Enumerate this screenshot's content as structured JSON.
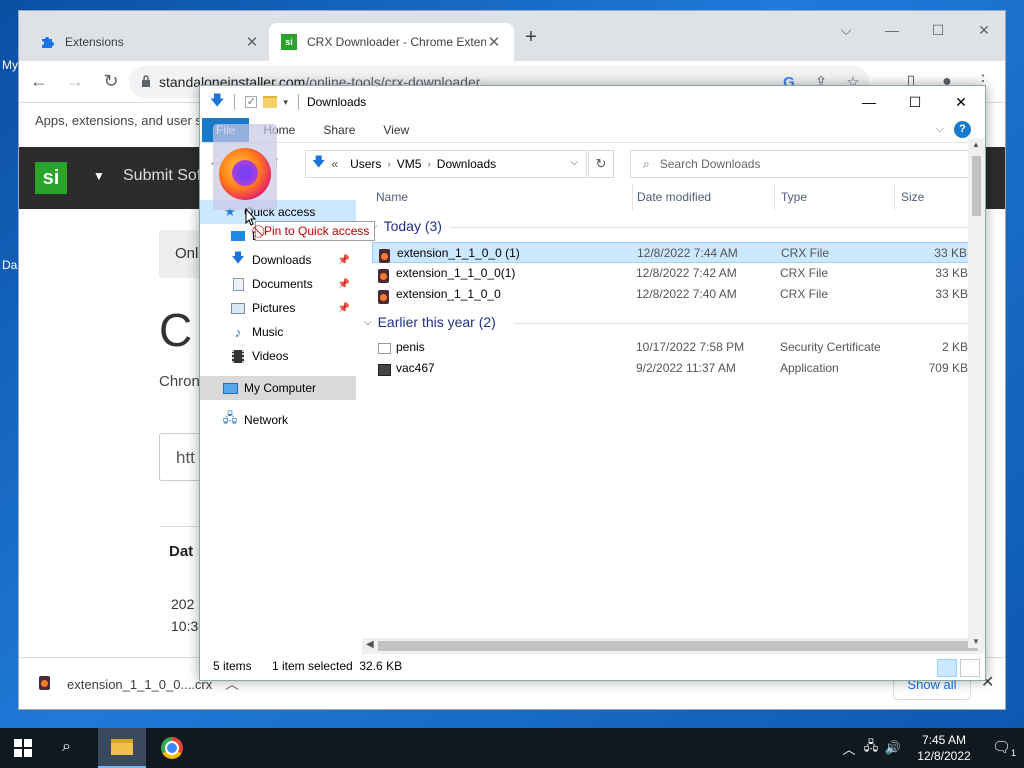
{
  "desktop": {
    "labels": [
      "My",
      "Da"
    ]
  },
  "browser": {
    "tabs": [
      {
        "title": "Extensions",
        "icon": "puzzle-icon",
        "active": false
      },
      {
        "title": "CRX Downloader - Chrome Exten",
        "icon": "si-favicon",
        "active": true
      }
    ],
    "url_host": "standaloneinstaller.com",
    "url_path": "/online-tools/crx-downloader"
  },
  "page": {
    "apps_text": "Apps, extensions, and user sc",
    "site_logo": "si",
    "submit_label": "Submit Sof",
    "pill_text": "Onl",
    "big_letter": "C",
    "chrome_text": "Chron",
    "input_text": "htt",
    "date_header": "Dat",
    "date_line1": "202",
    "date_line2": "10:3"
  },
  "download_bar": {
    "file_name": "extension_1_1_0_0....crx",
    "show_all": "Show all"
  },
  "explorer": {
    "title": "Downloads",
    "ribbon_tabs": [
      "File",
      "Home",
      "Share",
      "View"
    ],
    "breadcrumb": [
      "Users",
      "VM5",
      "Downloads"
    ],
    "search_placeholder": "Search Downloads",
    "nav": {
      "quick_access": "Quick access",
      "desktop": "D",
      "downloads": "Downloads",
      "documents": "Documents",
      "pictures": "Pictures",
      "music": "Music",
      "videos": "Videos",
      "my_computer": "My Computer",
      "network": "Network"
    },
    "columns": {
      "name": "Name",
      "date": "Date modified",
      "type": "Type",
      "size": "Size"
    },
    "groups": [
      {
        "label": "Today (3)",
        "files": [
          {
            "name": "extension_1_1_0_0 (1)",
            "date": "12/8/2022 7:44 AM",
            "type": "CRX File",
            "size": "33 KB",
            "selected": true
          },
          {
            "name": "extension_1_1_0_0(1)",
            "date": "12/8/2022 7:42 AM",
            "type": "CRX File",
            "size": "33 KB",
            "selected": false
          },
          {
            "name": "extension_1_1_0_0",
            "date": "12/8/2022 7:40 AM",
            "type": "CRX File",
            "size": "33 KB",
            "selected": false
          }
        ]
      },
      {
        "label": "Earlier this year (2)",
        "files": [
          {
            "name": "penis",
            "date": "10/17/2022 7:58 PM",
            "type": "Security Certificate",
            "size": "2 KB",
            "selected": false
          },
          {
            "name": "vac467",
            "date": "9/2/2022 11:37 AM",
            "type": "Application",
            "size": "709 KB",
            "selected": false
          }
        ]
      }
    ],
    "status": {
      "items": "5 items",
      "selected": "1 item selected  32.6 KB"
    },
    "tooltip": "Pin to Quick access"
  },
  "taskbar": {
    "time": "7:45 AM",
    "date": "12/8/2022",
    "notification_count": "1"
  }
}
